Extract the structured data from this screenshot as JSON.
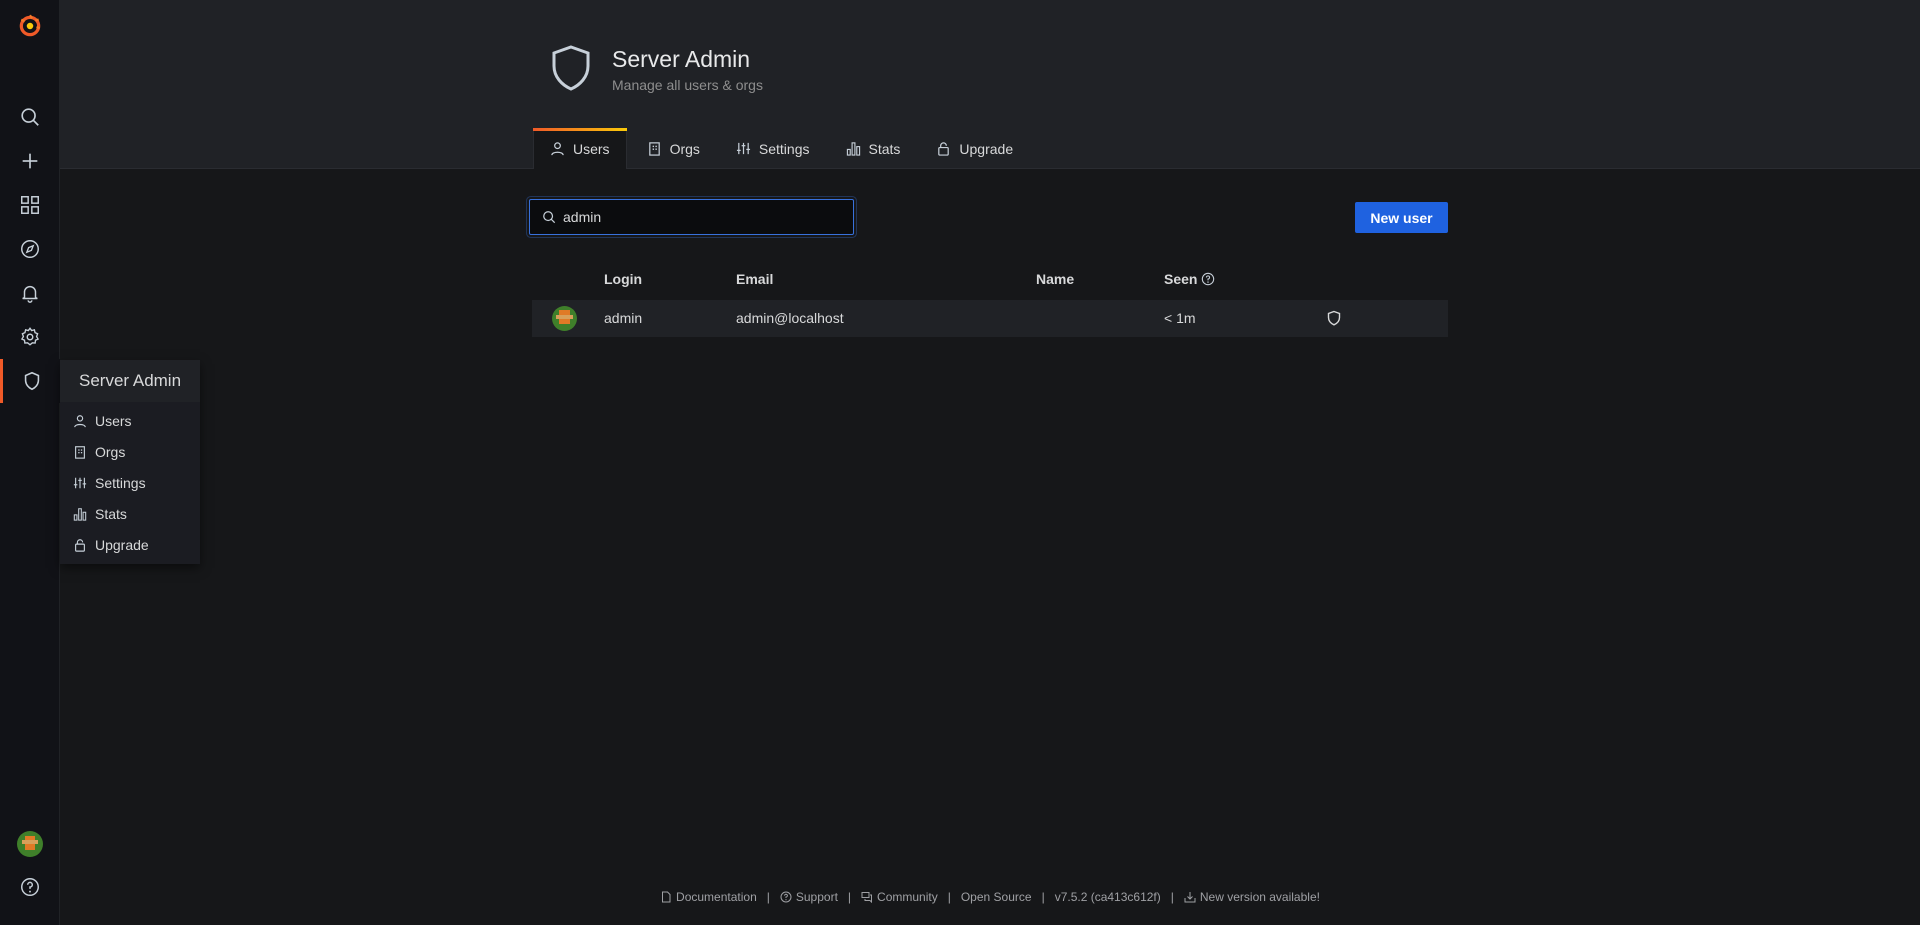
{
  "header": {
    "title": "Server Admin",
    "subtitle": "Manage all users & orgs"
  },
  "tabs": [
    {
      "label": "Users",
      "icon": "user-icon",
      "active": true
    },
    {
      "label": "Orgs",
      "icon": "building-icon"
    },
    {
      "label": "Settings",
      "icon": "sliders-icon"
    },
    {
      "label": "Stats",
      "icon": "bar-chart-icon"
    },
    {
      "label": "Upgrade",
      "icon": "lock-icon"
    }
  ],
  "search": {
    "value": "admin"
  },
  "new_user_label": "New user",
  "table": {
    "columns": [
      "Login",
      "Email",
      "Name",
      "Seen"
    ],
    "rows": [
      {
        "login": "admin",
        "email": "admin@localhost",
        "name": "",
        "seen": "< 1m",
        "is_admin": true
      }
    ]
  },
  "flyout": {
    "title": "Server Admin",
    "items": [
      "Users",
      "Orgs",
      "Settings",
      "Stats",
      "Upgrade"
    ]
  },
  "footer": {
    "documentation": "Documentation",
    "support": "Support",
    "community": "Community",
    "open_source": "Open Source",
    "version": "v7.5.2 (ca413c612f)",
    "new_version": "New version available!"
  },
  "colors": {
    "accent": "#f05a28",
    "primary_button": "#1f62e0",
    "focus_border": "#3871dc"
  }
}
